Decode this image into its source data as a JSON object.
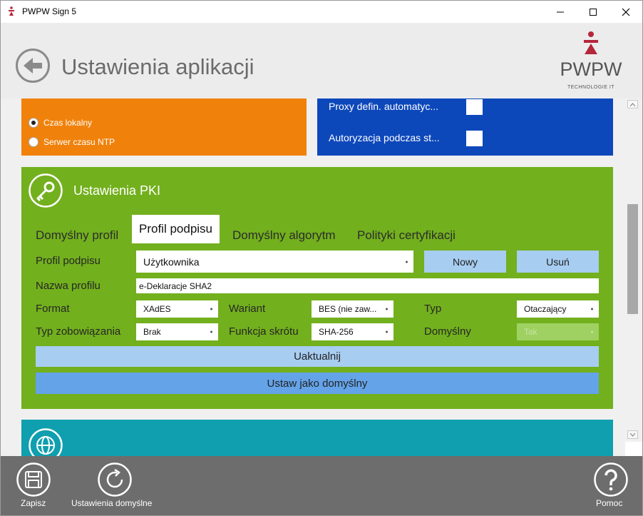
{
  "window": {
    "title": "PWPW Sign 5",
    "controls": [
      "minimize",
      "maximize",
      "close"
    ]
  },
  "header": {
    "title": "Ustawienia aplikacji",
    "back_icon": "back-arrow-icon",
    "logo_text": "PWPW",
    "logo_subtext": "TECHNOLOGIE IT"
  },
  "time_source": {
    "options": [
      {
        "label": "Czas lokalny",
        "selected": true
      },
      {
        "label": "Serwer czasu NTP",
        "selected": false
      }
    ]
  },
  "proxy": {
    "rows": [
      {
        "label": "Proxy defin. automatyc...",
        "checked": false
      },
      {
        "label": "Autoryzacja podczas st...",
        "checked": false
      }
    ]
  },
  "pki": {
    "title": "Ustawienia PKI",
    "tabs": [
      {
        "label": "Domyślny profil",
        "active": false
      },
      {
        "label": "Profil podpisu",
        "active": true
      },
      {
        "label": "Domyślny algorytm",
        "active": false
      },
      {
        "label": "Polityki certyfikacji",
        "active": false
      }
    ],
    "profile_label": "Profil podpisu",
    "profile_value": "Użytkownika",
    "new_button": "Nowy",
    "delete_button": "Usuń",
    "name_label": "Nazwa profilu",
    "name_value": "e-Deklaracje SHA2",
    "format_label": "Format",
    "format_value": "XAdES",
    "variant_label": "Wariant",
    "variant_value": "BES (nie zaw...",
    "type_label": "Typ",
    "type_value": "Otaczający",
    "commitment_label": "Typ zobowiązania",
    "commitment_value": "Brak",
    "hash_label": "Funkcja skrótu",
    "hash_value": "SHA-256",
    "default_label": "Domyślny",
    "default_value": "Tak",
    "update_button": "Uaktualnij",
    "set_default_button": "Ustaw jako domyślny"
  },
  "footer": {
    "save_label": "Zapisz",
    "defaults_label": "Ustawienia domyślne",
    "help_label": "Pomoc"
  },
  "colors": {
    "orange": "#f0820c",
    "blue": "#0d48bb",
    "green": "#72b01d",
    "teal": "#0f9fae",
    "footer": "#6d6d6d",
    "logo_red": "#b5263b"
  }
}
